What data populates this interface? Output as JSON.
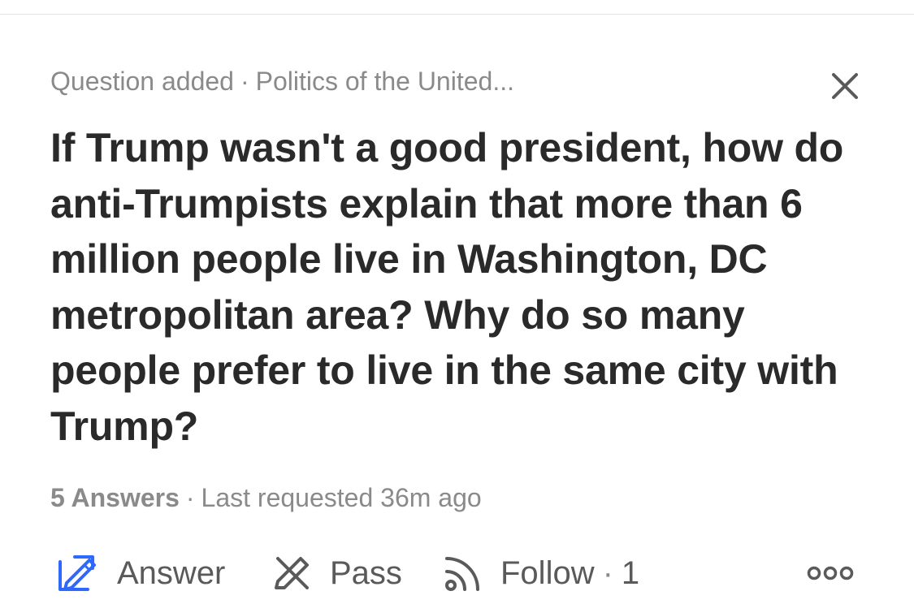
{
  "question": {
    "meta_status": "Question added",
    "meta_separator": "·",
    "meta_topic": "Politics of the United...",
    "title": "If Trump wasn't a good president, how do anti-Trumpists explain that more than 6 million people live in Washington, DC metropolitan area? Why do so many people prefer to live in the same city with Trump?",
    "answers_count": "5 Answers",
    "stats_separator": "·",
    "last_requested": "Last requested 36m ago"
  },
  "actions": {
    "answer_label": "Answer",
    "pass_label": "Pass",
    "follow_label": "Follow",
    "follow_separator": "·",
    "follow_count": "1"
  },
  "icons": {
    "close": "close-icon",
    "answer": "pencil-square-icon",
    "pass": "pencil-cross-icon",
    "follow": "rss-icon",
    "more": "more-dots-icon"
  },
  "colors": {
    "accent": "#2e69ff",
    "text_primary": "#2a2a2a",
    "text_secondary": "#8a8a8a",
    "icon": "#5a5a5a"
  }
}
